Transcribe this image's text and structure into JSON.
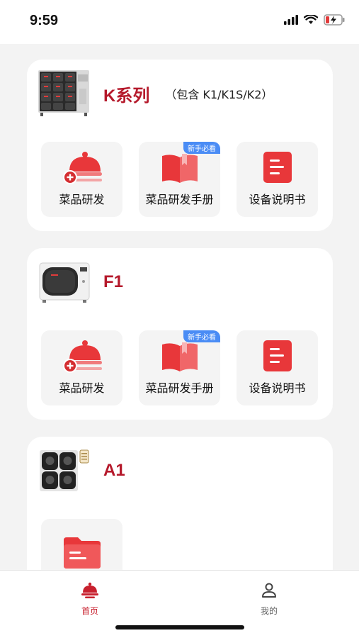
{
  "status_bar": {
    "time": "9:59"
  },
  "colors": {
    "accent": "#b5192b",
    "icon_red": "#e8373a",
    "badge_blue": "#4a8cf5",
    "tab_active": "#c8202e",
    "tab_inactive": "#666666"
  },
  "cards": [
    {
      "title": "K系列",
      "subtitle": "（包含 K1/K1S/K2）",
      "device_icon": "k-series-cabinet-icon",
      "tiles": [
        {
          "label": "菜品研发",
          "icon": "cloche-plus-icon",
          "badge": ""
        },
        {
          "label": "菜品研发手册",
          "icon": "book-icon",
          "badge": "新手必看"
        },
        {
          "label": "设备说明书",
          "icon": "manual-icon",
          "badge": ""
        }
      ]
    },
    {
      "title": "F1",
      "subtitle": "",
      "device_icon": "f1-oven-icon",
      "tiles": [
        {
          "label": "菜品研发",
          "icon": "cloche-plus-icon",
          "badge": ""
        },
        {
          "label": "菜品研发手册",
          "icon": "book-icon",
          "badge": "新手必看"
        },
        {
          "label": "设备说明书",
          "icon": "manual-icon",
          "badge": ""
        }
      ]
    },
    {
      "title": "A1",
      "subtitle": "",
      "device_icon": "a1-pots-icon",
      "tiles": [
        {
          "label": "",
          "icon": "folder-icon",
          "badge": ""
        }
      ]
    }
  ],
  "tabbar": {
    "home_label": "首页",
    "mine_label": "我的",
    "active": "home"
  }
}
